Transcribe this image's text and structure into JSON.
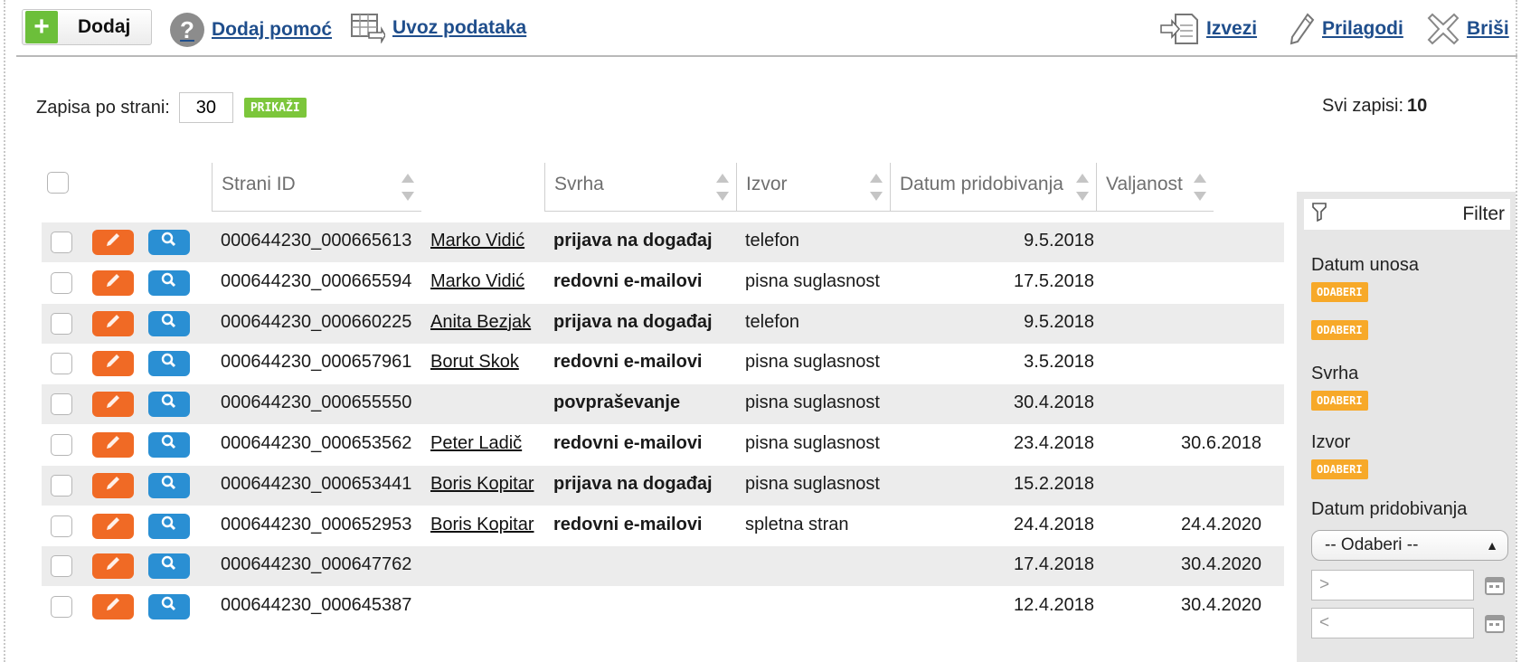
{
  "toolbar": {
    "add_label": "Dodaj",
    "help_label": "Dodaj pomoć",
    "import_label": "Uvoz podataka",
    "export_label": "Izvezi",
    "customize_label": "Prilagodi",
    "delete_label": "Briši"
  },
  "paging": {
    "per_page_label": "Zapisa po strani:",
    "per_page_value": "30",
    "show_button": "PRIKAŽI",
    "total_label": "Svi zapisi:",
    "total_value": "10"
  },
  "table": {
    "headers": {
      "foreign_id": "Strani ID",
      "purpose": "Svrha",
      "source": "Izvor",
      "date_obtained": "Datum pridobivanja",
      "validity": "Valjanost"
    },
    "rows": [
      {
        "id": "000644230_000665613",
        "name": "Marko Vidić",
        "purpose": "prijava na događaj",
        "source": "telefon",
        "date": "9.5.2018",
        "valid": ""
      },
      {
        "id": "000644230_000665594",
        "name": "Marko Vidić",
        "purpose": "redovni e-mailovi",
        "source": "pisna suglasnost",
        "date": "17.5.2018",
        "valid": ""
      },
      {
        "id": "000644230_000660225",
        "name": "Anita Bezjak",
        "purpose": "prijava na događaj",
        "source": "telefon",
        "date": "9.5.2018",
        "valid": ""
      },
      {
        "id": "000644230_000657961",
        "name": "Borut Skok",
        "purpose": "redovni e-mailovi",
        "source": "pisna suglasnost",
        "date": "3.5.2018",
        "valid": ""
      },
      {
        "id": "000644230_000655550",
        "name": "",
        "purpose": "povpraševanje",
        "source": "pisna suglasnost",
        "date": "30.4.2018",
        "valid": ""
      },
      {
        "id": "000644230_000653562",
        "name": "Peter Ladič",
        "purpose": "redovni e-mailovi",
        "source": "pisna suglasnost",
        "date": "23.4.2018",
        "valid": "30.6.2018"
      },
      {
        "id": "000644230_000653441",
        "name": "Boris Kopitar",
        "purpose": "prijava na događaj",
        "source": "pisna suglasnost",
        "date": "15.2.2018",
        "valid": ""
      },
      {
        "id": "000644230_000652953",
        "name": "Boris Kopitar",
        "purpose": "redovni e-mailovi",
        "source": "spletna stran",
        "date": "24.4.2018",
        "valid": "24.4.2020"
      },
      {
        "id": "000644230_000647762",
        "name": "",
        "purpose": "",
        "source": "",
        "date": "17.4.2018",
        "valid": "30.4.2020"
      },
      {
        "id": "000644230_000645387",
        "name": "",
        "purpose": "",
        "source": "",
        "date": "12.4.2018",
        "valid": "30.4.2020"
      }
    ]
  },
  "filter": {
    "title": "Filter",
    "date_entered_label": "Datum unosa",
    "choose_button": "ODABERI",
    "purpose_label": "Svrha",
    "source_label": "Izvor",
    "date_obtained_label": "Datum pridobivanja",
    "select_value": "-- Odaberi --",
    "gt_placeholder": ">",
    "lt_placeholder": "<"
  },
  "colors": {
    "accent_green": "#7cc63b",
    "edit_orange": "#f06a25",
    "view_blue": "#2a8fd3",
    "choose_orange": "#f7a929",
    "link_blue": "#1f4e8c"
  }
}
